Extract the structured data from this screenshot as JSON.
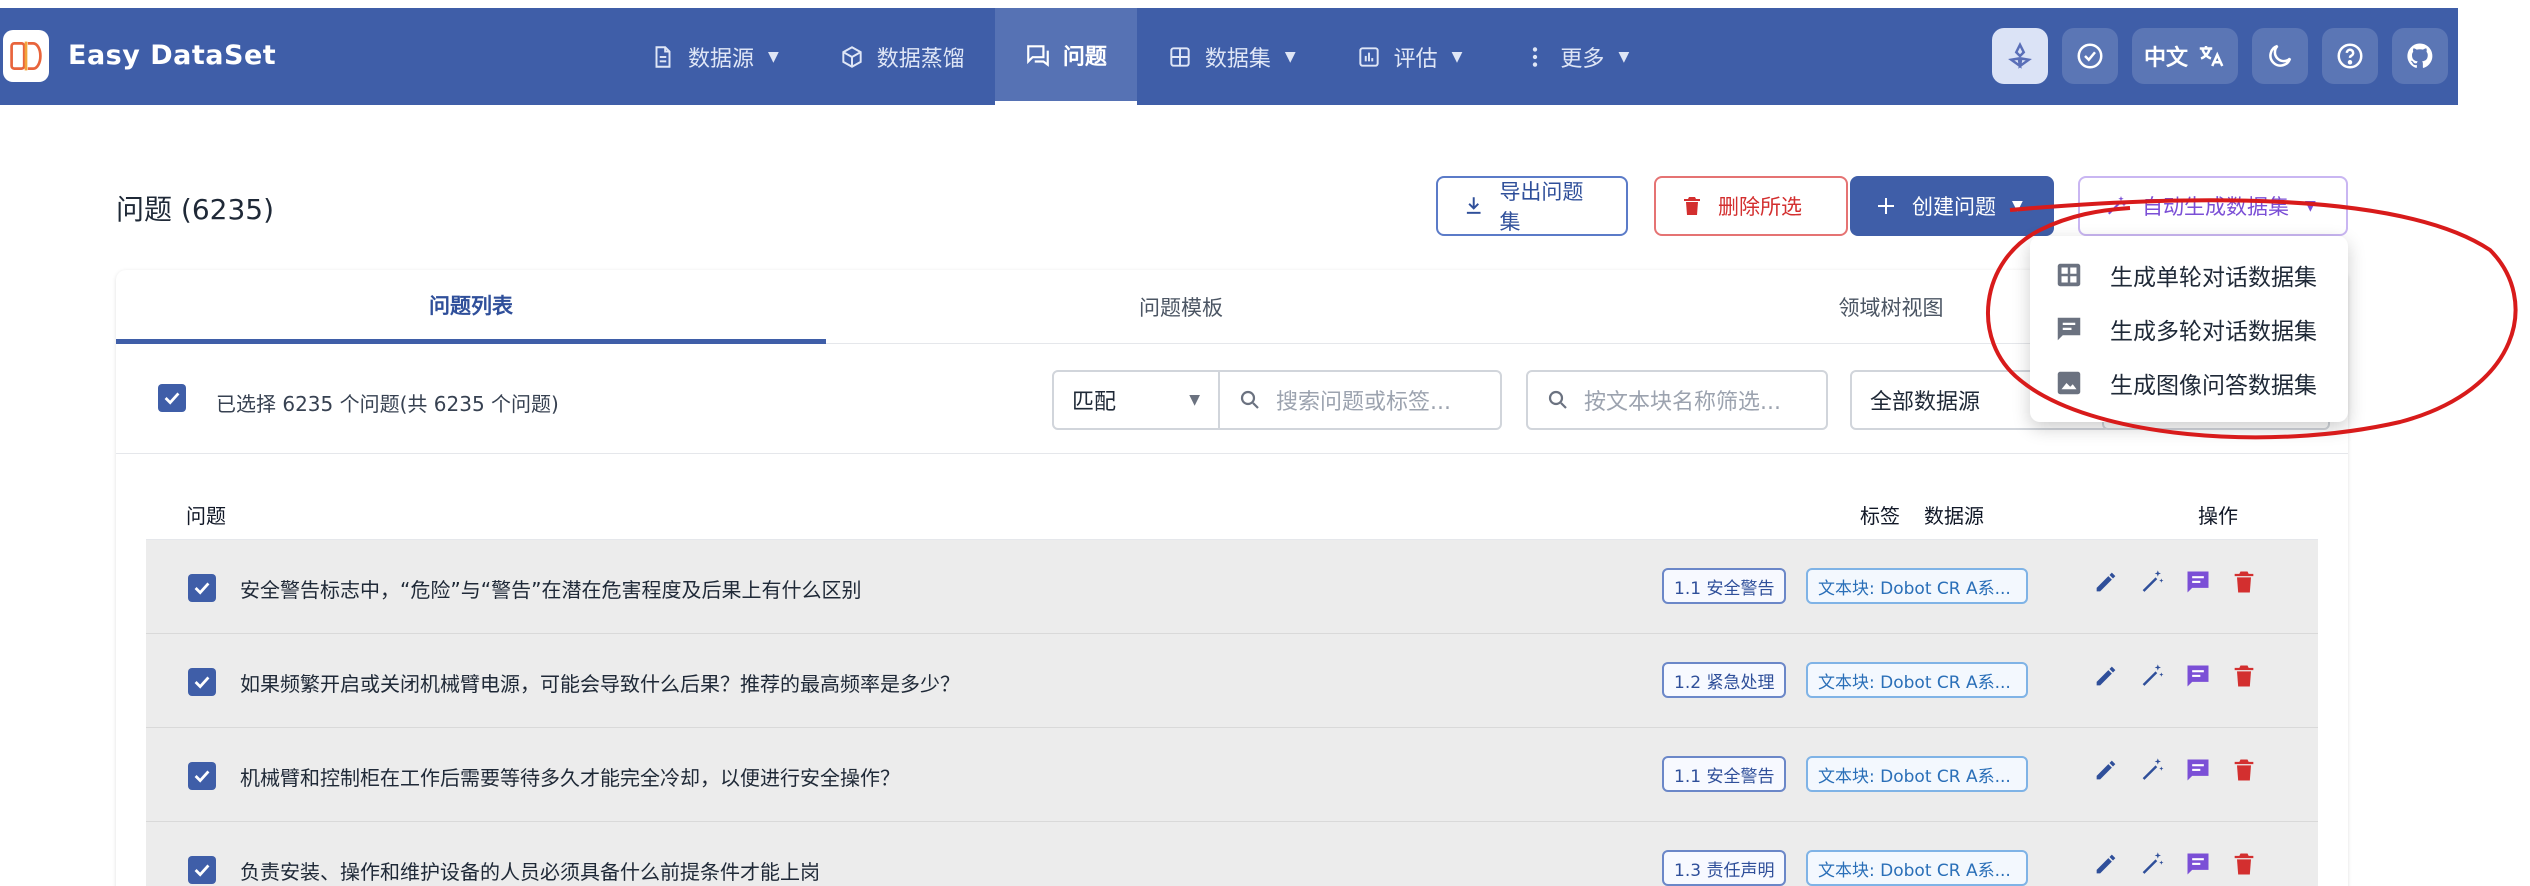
{
  "app": {
    "title": "Easy DataSet"
  },
  "nav": {
    "items": [
      {
        "label": "数据源",
        "icon": "file-icon",
        "has_caret": true
      },
      {
        "label": "数据蒸馏",
        "icon": "cube-icon",
        "has_caret": false
      },
      {
        "label": "问题",
        "icon": "chat-icon",
        "has_caret": false,
        "active": true
      },
      {
        "label": "数据集",
        "icon": "grid-icon",
        "has_caret": true
      },
      {
        "label": "评估",
        "icon": "chart-icon",
        "has_caret": true
      },
      {
        "label": "更多",
        "icon": "more-vertical-icon",
        "has_caret": true
      }
    ]
  },
  "tools": {
    "language": "中文"
  },
  "page": {
    "title": "问题 (6235)"
  },
  "buttons": {
    "export": "导出问题集",
    "delete": "删除所选",
    "create": "创建问题",
    "auto": "自动生成数据集"
  },
  "tabs": [
    "问题列表",
    "问题模板",
    "领域树视图"
  ],
  "filters": {
    "selection_text": "已选择 6235 个问题(共 6235 个问题)",
    "match_mode": "匹配",
    "search_placeholder": "搜索问题或标签...",
    "chunk_placeholder": "按文本块名称筛选...",
    "source": "全部数据源"
  },
  "table": {
    "headers": {
      "question": "问题",
      "tag": "标签",
      "source": "数据源",
      "actions": "操作"
    },
    "rows": [
      {
        "question": "安全警告标志中，“危险”与“警告”在潜在危害程度及后果上有什么区别",
        "tag": "1.1 安全警告",
        "source": "文本块: Dobot CR A系..."
      },
      {
        "question": "如果频繁开启或关闭机械臂电源，可能会导致什么后果？推荐的最高频率是多少？",
        "tag": "1.2 紧急处理",
        "source": "文本块: Dobot CR A系..."
      },
      {
        "question": "机械臂和控制柜在工作后需要等待多久才能完全冷却，以便进行安全操作？",
        "tag": "1.1 安全警告",
        "source": "文本块: Dobot CR A系..."
      },
      {
        "question": "负责安装、操作和维护设备的人员必须具备什么前提条件才能上岗",
        "tag": "1.3 责任声明",
        "source": "文本块: Dobot CR A系..."
      }
    ]
  },
  "menu": {
    "items": [
      {
        "label": "生成单轮对话数据集",
        "icon": "grid-icon"
      },
      {
        "label": "生成多轮对话数据集",
        "icon": "message-icon"
      },
      {
        "label": "生成图像问答数据集",
        "icon": "image-icon"
      }
    ]
  },
  "colors": {
    "primary": "#3f5ea8",
    "danger": "#d32f2f",
    "accent_purple": "#7b4fd6",
    "annotation_red": "#d81b1b"
  }
}
